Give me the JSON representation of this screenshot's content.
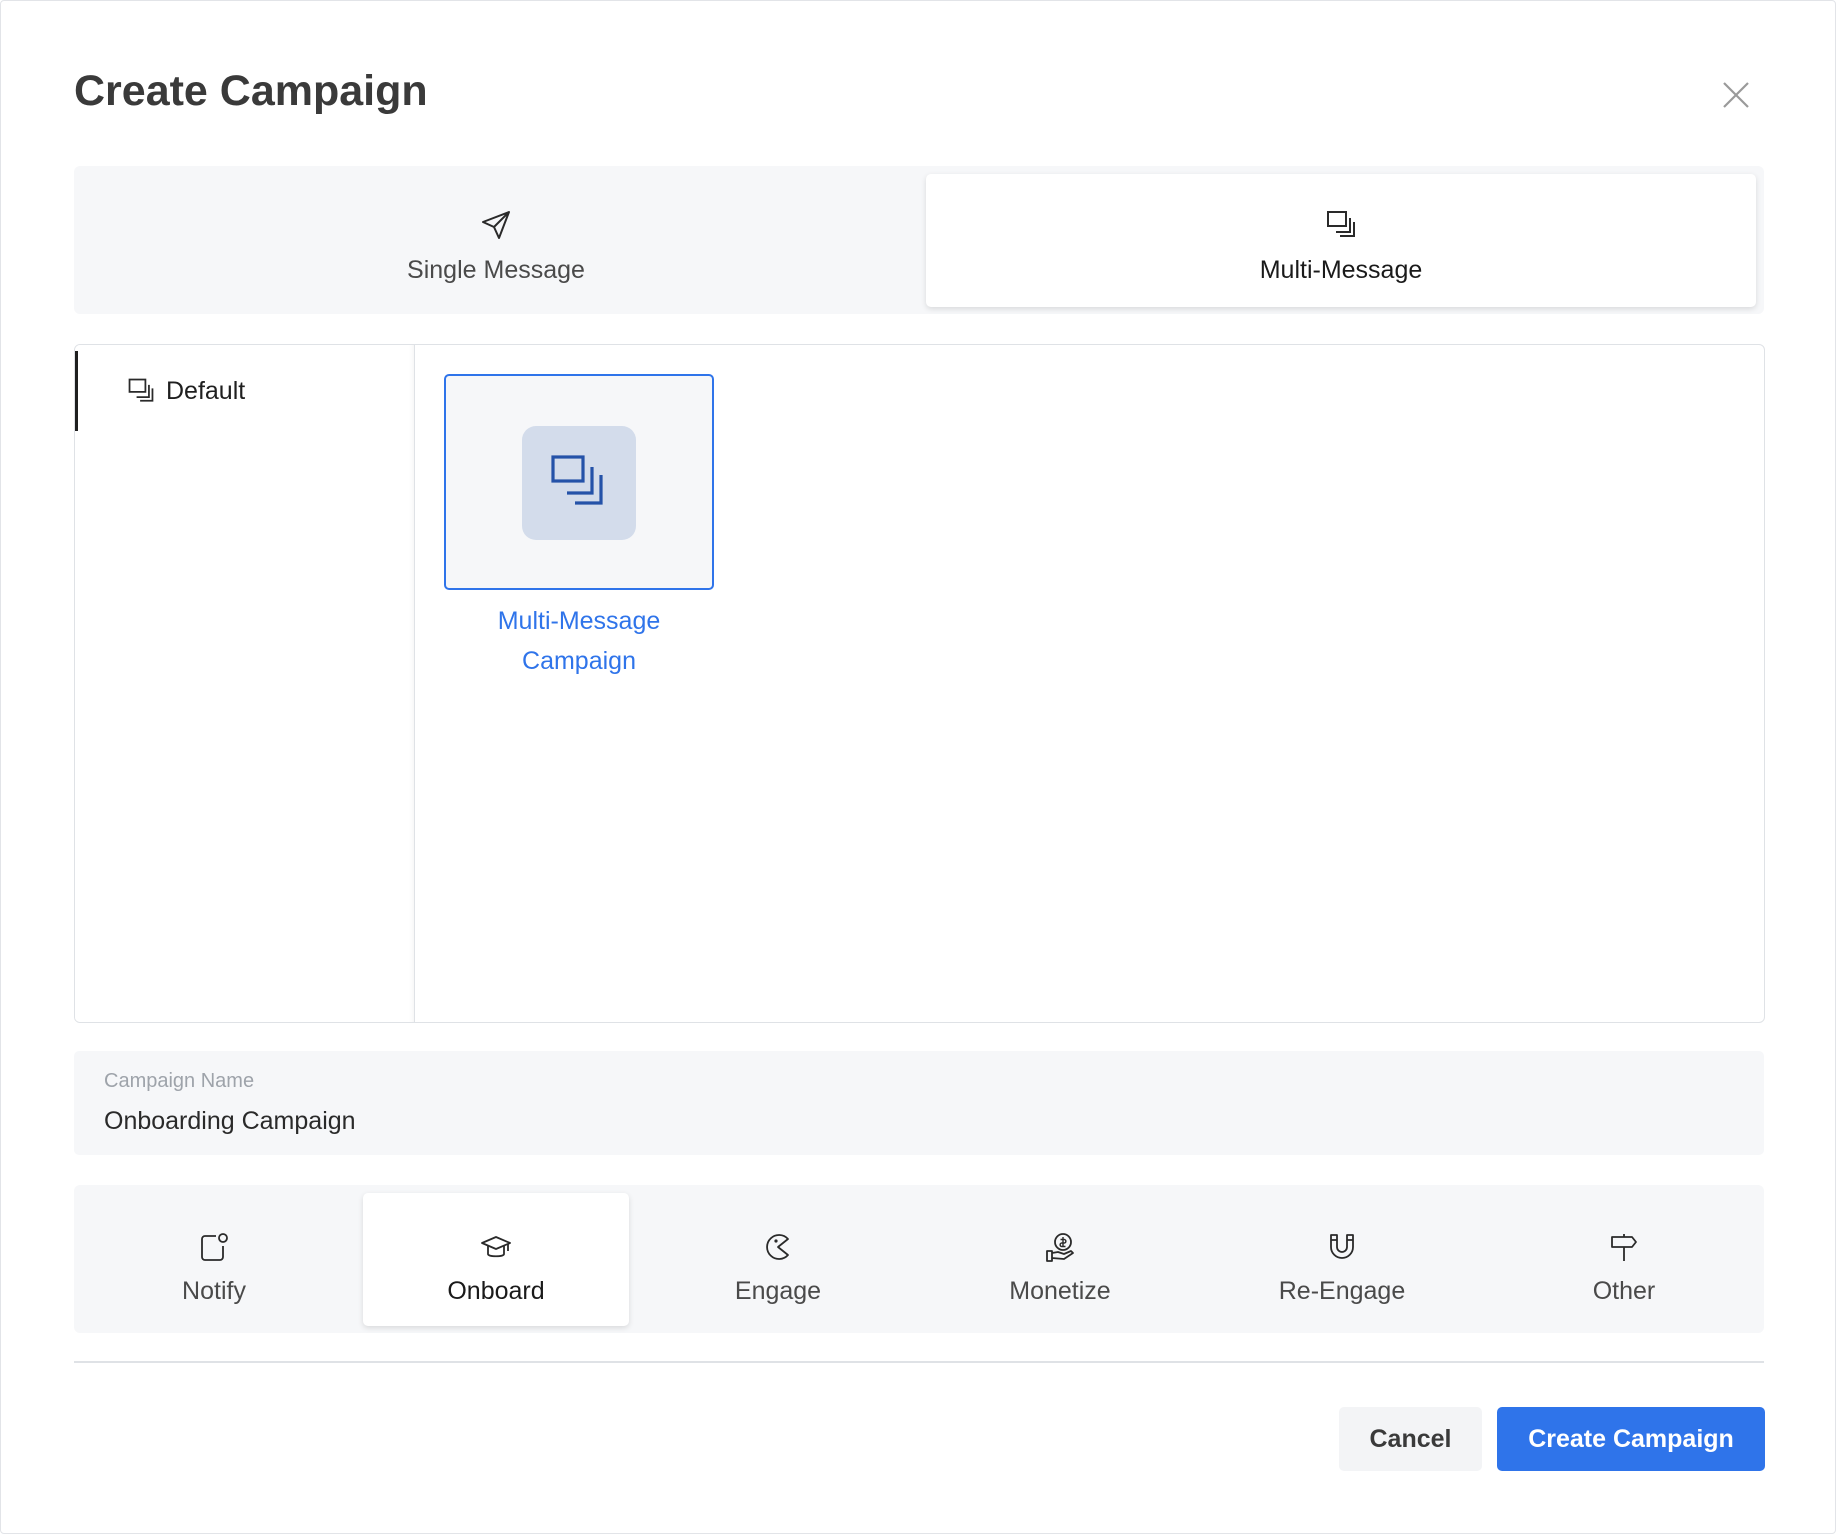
{
  "modal": {
    "title": "Create Campaign",
    "close_icon": "close-icon"
  },
  "type_tabs": [
    {
      "label": "Single Message",
      "icon": "paper-plane-icon",
      "active": false
    },
    {
      "label": "Multi-Message",
      "icon": "stacked-squares-icon",
      "active": true
    }
  ],
  "template_sidebar": {
    "items": [
      {
        "label": "Default",
        "icon": "stacked-squares-icon",
        "active": true
      }
    ]
  },
  "templates": [
    {
      "label": "Multi-Message Campaign",
      "icon": "stacked-squares-icon",
      "selected": true
    }
  ],
  "campaign_name": {
    "label": "Campaign Name",
    "value": "Onboarding Campaign"
  },
  "categories": [
    {
      "label": "Notify",
      "icon": "notification-icon",
      "active": false
    },
    {
      "label": "Onboard",
      "icon": "graduation-cap-icon",
      "active": true
    },
    {
      "label": "Engage",
      "icon": "pacman-icon",
      "active": false
    },
    {
      "label": "Monetize",
      "icon": "money-hand-icon",
      "active": false
    },
    {
      "label": "Re-Engage",
      "icon": "magnet-icon",
      "active": false
    },
    {
      "label": "Other",
      "icon": "signpost-icon",
      "active": false
    }
  ],
  "footer": {
    "cancel_label": "Cancel",
    "create_label": "Create Campaign"
  },
  "colors": {
    "accent": "#2f74ea",
    "panel_bg": "#f6f7f9",
    "card_icon_bg": "#d3dceb"
  }
}
